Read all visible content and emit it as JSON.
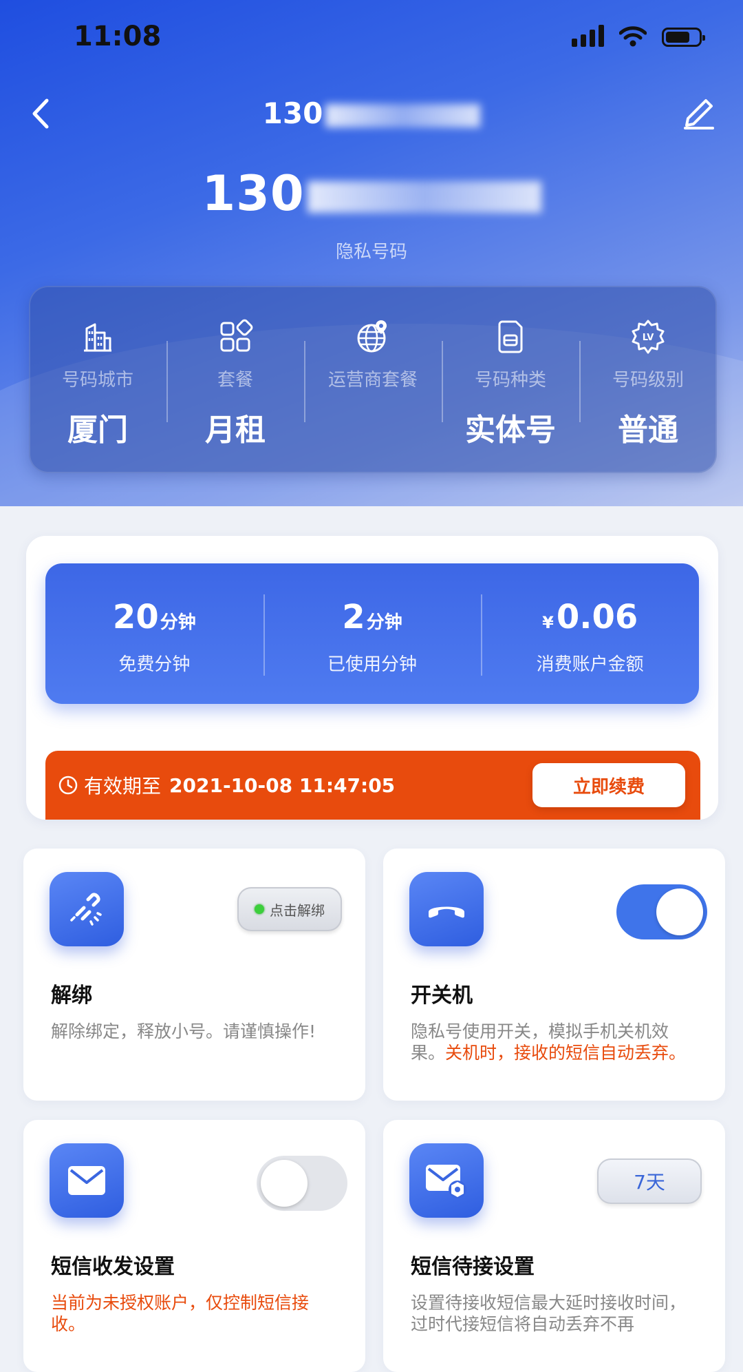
{
  "status_bar": {
    "time": "11:08"
  },
  "nav": {
    "title_prefix": "130"
  },
  "number": {
    "prefix": "130",
    "subtitle": "隐私号码"
  },
  "info": [
    {
      "icon": "building-icon",
      "label": "号码城市",
      "value": "厦门"
    },
    {
      "icon": "package-grid-icon",
      "label": "套餐",
      "value": "月租"
    },
    {
      "icon": "globe-pin-icon",
      "label": "运营商套餐",
      "value": ""
    },
    {
      "icon": "sim-card-icon",
      "label": "号码种类",
      "value": "实体号"
    },
    {
      "icon": "level-badge-icon",
      "label": "号码级别",
      "value": "普通"
    }
  ],
  "stats": {
    "free_minutes": {
      "value": "20",
      "unit": "分钟",
      "label": "免费分钟"
    },
    "used_minutes": {
      "value": "2",
      "unit": "分钟",
      "label": "已使用分钟"
    },
    "balance": {
      "currency": "¥",
      "value": "0.06",
      "label": "消费账户金额"
    }
  },
  "expiry": {
    "label": "有效期至",
    "date": "2021-10-08 11:47:05",
    "renew_label": "立即续费"
  },
  "features": {
    "unbind": {
      "title": "解绑",
      "chip": "点击解绑",
      "desc": "解除绑定，释放小号。请谨慎操作!"
    },
    "power": {
      "title": "开关机",
      "desc": "隐私号使用开关，模拟手机关机效果。",
      "warn": "关机时，接收的短信自动丢弃。",
      "toggle": "on"
    },
    "sms": {
      "title": "短信收发设置",
      "warn": "当前为未授权账户，仅控制短信接收。",
      "toggle": "off"
    },
    "pending": {
      "title": "短信待接设置",
      "chip": "7天",
      "desc": "设置待接收短信最大延时接收时间，过时代接短信将自动丢弃不再"
    }
  },
  "colors": {
    "primary": "#3f74ea",
    "accent_orange": "#e84b0d"
  }
}
